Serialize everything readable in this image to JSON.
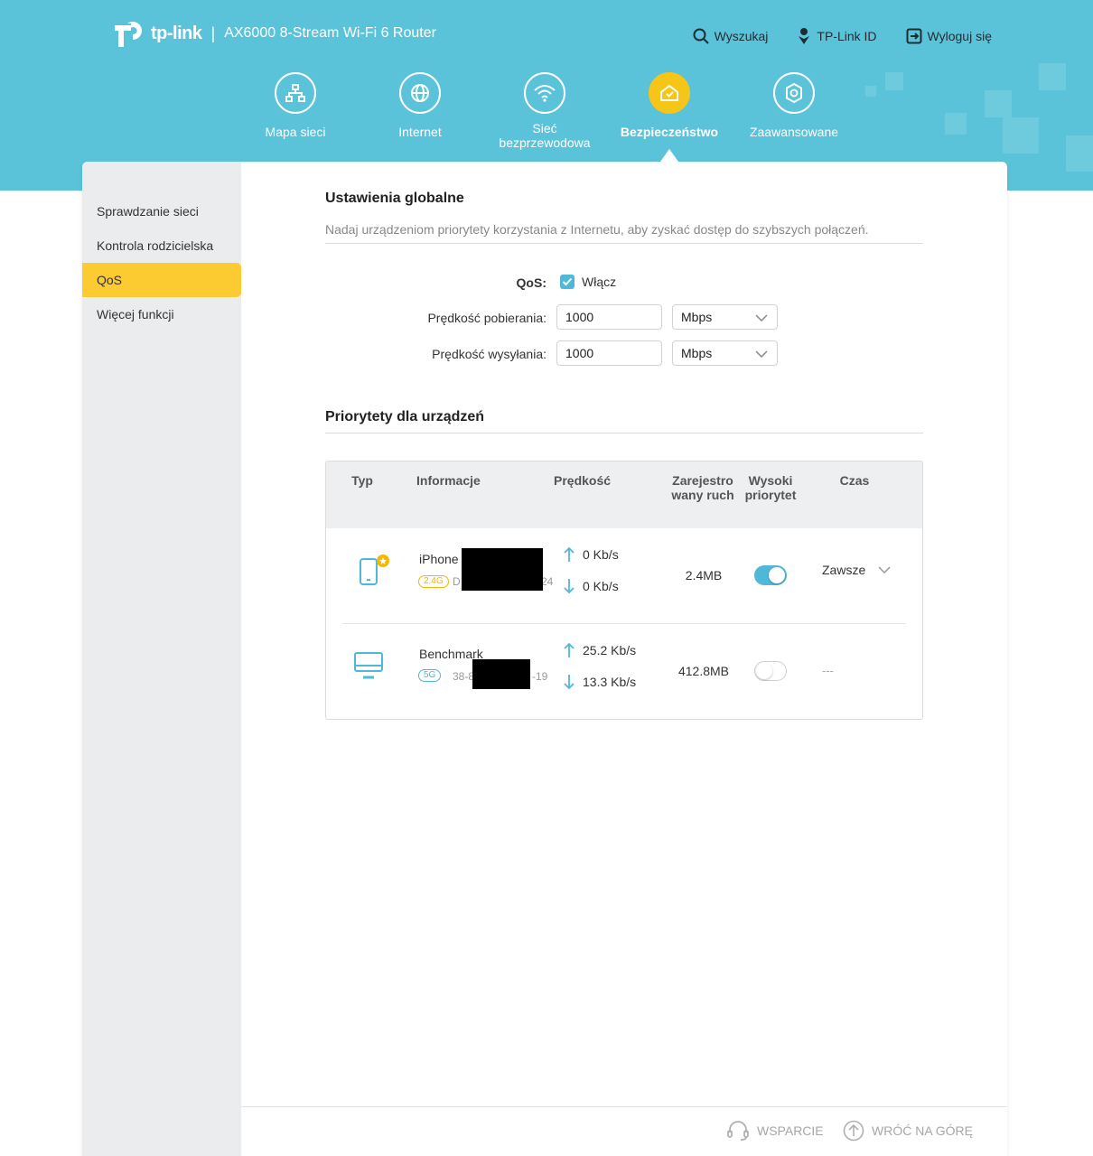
{
  "brand": {
    "logo_text": "tp-link",
    "model": "AX6000 8-Stream Wi-Fi 6 Router"
  },
  "top_links": {
    "search": "Wyszukaj",
    "tplink_id": "TP-Link ID",
    "logout": "Wyloguj się"
  },
  "nav": [
    {
      "label": "Mapa sieci",
      "icon": "network-map-icon"
    },
    {
      "label": "Internet",
      "icon": "globe-icon"
    },
    {
      "label": "Sieć bezprzewodowa",
      "icon": "wifi-icon"
    },
    {
      "label": "Bezpieczeństwo",
      "icon": "security-house-icon",
      "active": true
    },
    {
      "label": "Zaawansowane",
      "icon": "gear-icon"
    }
  ],
  "sidebar": {
    "items": [
      {
        "label": "Sprawdzanie sieci"
      },
      {
        "label": "Kontrola rodzicielska"
      },
      {
        "label": "QoS",
        "active": true
      },
      {
        "label": "Więcej funkcji"
      }
    ]
  },
  "global": {
    "title": "Ustawienia globalne",
    "description": "Nadaj urządzeniom priorytety korzystania z Internetu, aby zyskać dostęp do szybszych połączeń.",
    "qos_label": "QoS:",
    "qos_enable": "Włącz",
    "download_label": "Prędkość pobierania:",
    "download_value": "1000",
    "download_unit": "Mbps",
    "upload_label": "Prędkość wysyłania:",
    "upload_value": "1000",
    "upload_unit": "Mbps"
  },
  "devices": {
    "title": "Priorytety dla urządzeń",
    "headers": {
      "type": "Typ",
      "info": "Informacje",
      "speed": "Prędkość",
      "traffic": "Zarejestro wany ruch",
      "priority": "Wysoki priorytet",
      "time": "Czas"
    },
    "rows": [
      {
        "type_icon": "smartphone-icon",
        "name": "iPhone",
        "band": "2.4G",
        "mac_prefix": "D",
        "mac_suffix": "24",
        "up": "0 Kb/s",
        "down": "0 Kb/s",
        "traffic": "2.4MB",
        "high_priority": true,
        "time": "Zawsze"
      },
      {
        "type_icon": "monitor-icon",
        "name": "Benchmark",
        "band": "5G",
        "mac_prefix": "38-8",
        "mac_suffix": "-19",
        "up": "25.2 Kb/s",
        "down": "13.3 Kb/s",
        "traffic": "412.8MB",
        "high_priority": false,
        "time": "---"
      }
    ]
  },
  "footer": {
    "support": "WSPARCIE",
    "back_to_top": "WRÓĆ NA GÓRĘ"
  }
}
